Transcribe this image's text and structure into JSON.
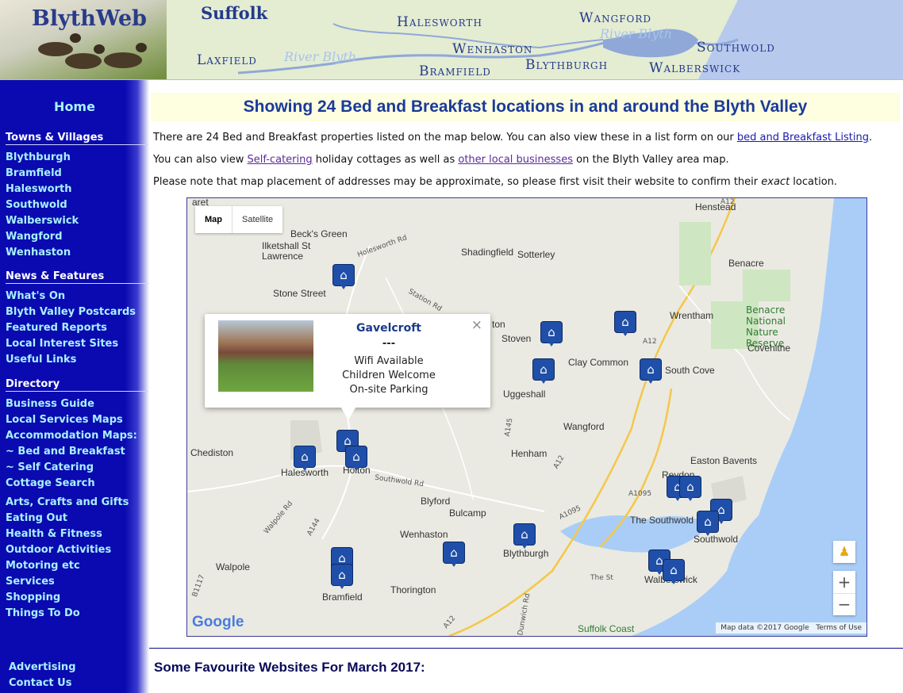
{
  "header": {
    "logo_title": "BlythWeb",
    "county": "Suffolk",
    "places": [
      "Halesworth",
      "Wangford",
      "Wenhaston",
      "Southwold",
      "Laxfield",
      "Bramfield",
      "Blythburgh",
      "Walberswick"
    ],
    "rivers": [
      "River Blyth",
      "River Blyth"
    ]
  },
  "sidebar": {
    "home": "Home",
    "sections": [
      {
        "title": "Towns & Villages",
        "items": [
          "Blythburgh",
          "Bramfield",
          "Halesworth",
          "Southwold",
          "Walberswick",
          "Wangford",
          "Wenhaston"
        ]
      },
      {
        "title": "News & Features",
        "items": [
          "What's On",
          "Blyth Valley Postcards",
          "Featured Reports",
          "Local Interest Sites",
          "Useful Links"
        ]
      },
      {
        "title": "Directory",
        "items": [
          "Business Guide",
          "Local Services Maps",
          "Accommodation Maps:",
          "~ Bed and Breakfast",
          "~ Self Catering",
          "Cottage Search",
          "Arts, Crafts and Gifts",
          "Eating Out",
          "Health & Fitness",
          "Outdoor Activities",
          "Motoring etc",
          "Services",
          "Shopping",
          "Things To Do"
        ]
      }
    ],
    "bottom": [
      "Advertising",
      "Contact Us"
    ]
  },
  "main": {
    "heading": "Showing 24 Bed and Breakfast locations in and around the Blyth Valley",
    "p1_text": "There are 24 Bed and Breakfast properties listed on the map below. You can also view these in a list form on our ",
    "p1_link": "bed and Breakfast Listing",
    "p1_end": ".",
    "p2_text": "You can also view ",
    "p2_link1": "Self-catering",
    "p2_mid": " holiday cottages as well as ",
    "p2_link2": "other local businesses",
    "p2_end": " on the Blyth Valley area map.",
    "p3_text": "Please note that map placement of addresses may be approximate, so please first visit their website to confirm their ",
    "p3_em": "exact",
    "p3_end": " location.",
    "favourite": "Some Favourite Websites For March 2017:"
  },
  "map": {
    "type_map": "Map",
    "type_satellite": "Satellite",
    "popup": {
      "title": "Gavelcroft",
      "sep": "---",
      "lines": [
        "Wifi Available",
        "Children Welcome",
        "On-site Parking"
      ],
      "close": "×"
    },
    "labels": [
      "Henstead",
      "Beck's Green",
      "Ilketshall St Lawrence",
      "Shadingfield",
      "Sotterley",
      "Benacre",
      "Stone Street",
      "Wrentham",
      "Stoven",
      "Clay Common",
      "Covehithe",
      "South Cove",
      "Uggeshall",
      "Wangford",
      "Chediston",
      "Halesworth",
      "Holton",
      "Henham",
      "Easton Bavents",
      "Reydon",
      "Blyford",
      "Bulcamp",
      "The Southwold",
      "Southwold",
      "Wenhaston",
      "Blythburgh",
      "Walpole",
      "Walberswick",
      "Bramfield",
      "Thorington",
      "Suffolk Coast",
      "aret",
      "ton"
    ],
    "reserve": "Benacre National Nature Reserve",
    "roads": [
      "Holesworth Rd",
      "Station Rd",
      "A12",
      "A12",
      "A145",
      "A12",
      "Southwold Rd",
      "A1095",
      "A1095",
      "A144",
      "Walpole Rd",
      "The St",
      "B1117",
      "Dunwich Rd",
      "A12"
    ],
    "pin_icon": "house-icon",
    "pin_count": 24,
    "zoom_in": "+",
    "zoom_out": "−",
    "attribution": "Map data ©2017 Google",
    "terms": "Terms of Use",
    "google": "Google"
  }
}
